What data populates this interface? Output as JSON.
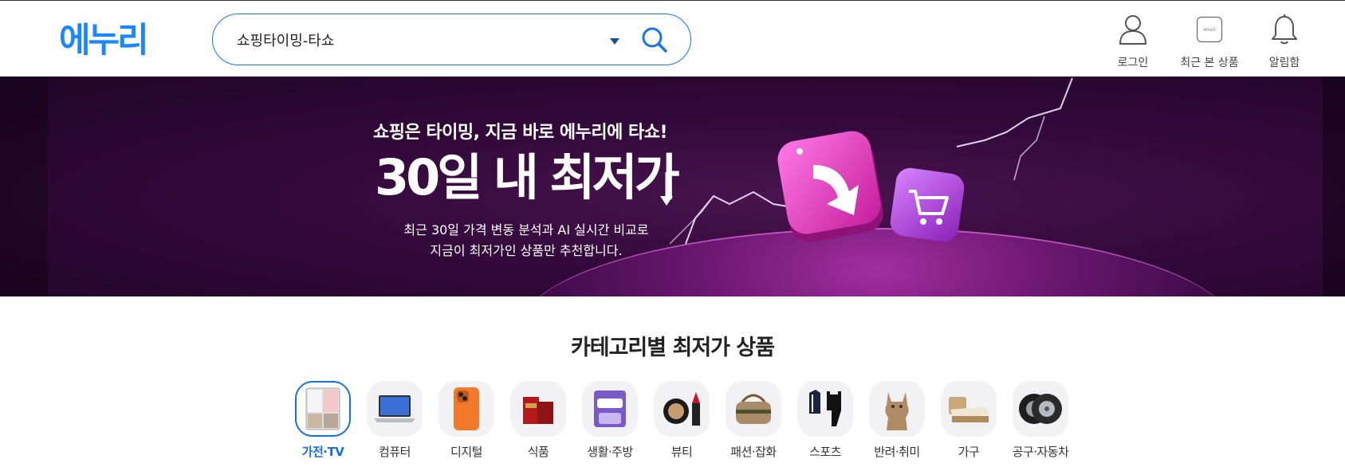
{
  "header": {
    "logo_text": "에누리",
    "search": {
      "value": "쇼핑타이밍-타쇼",
      "placeholder": ""
    },
    "utilities": [
      {
        "label": "로그인",
        "icon": "user-icon"
      },
      {
        "label": "최근 본 상품",
        "icon": "recent-items-icon",
        "box_text": "enuri"
      },
      {
        "label": "알림함",
        "icon": "bell-icon"
      }
    ]
  },
  "banner": {
    "tagline": "쇼핑은 타이밍, 지금 바로 에누리에 타쇼!",
    "headline": "30일 내 최저가",
    "description_line1": "최근 30일 가격 변동 분석과 AI 실시간 비교로",
    "description_line2": "지금이 최저가인 상품만 추천합니다."
  },
  "category": {
    "title": "카테고리별 최저가 상품",
    "items": [
      {
        "label": "가전·TV",
        "active": true,
        "icon": "refrigerator-icon"
      },
      {
        "label": "컴퓨터",
        "active": false,
        "icon": "laptop-icon"
      },
      {
        "label": "디지털",
        "active": false,
        "icon": "smartphone-icon"
      },
      {
        "label": "식품",
        "active": false,
        "icon": "red-ginseng-icon"
      },
      {
        "label": "생활·주방",
        "active": false,
        "icon": "tissue-pack-icon"
      },
      {
        "label": "뷰티",
        "active": false,
        "icon": "cosmetics-icon"
      },
      {
        "label": "패션·잡화",
        "active": false,
        "icon": "handbag-icon"
      },
      {
        "label": "스포츠",
        "active": false,
        "icon": "sportswear-icon"
      },
      {
        "label": "반려·취미",
        "active": false,
        "icon": "cat-icon"
      },
      {
        "label": "가구",
        "active": false,
        "icon": "bed-icon"
      },
      {
        "label": "공구·자동차",
        "active": false,
        "icon": "tire-icon"
      }
    ]
  },
  "colors": {
    "brand_blue": "#1a86ff",
    "active_blue": "#1a6fe0",
    "banner_purple": "#32093a",
    "banner_pink": "#e83ec0"
  }
}
